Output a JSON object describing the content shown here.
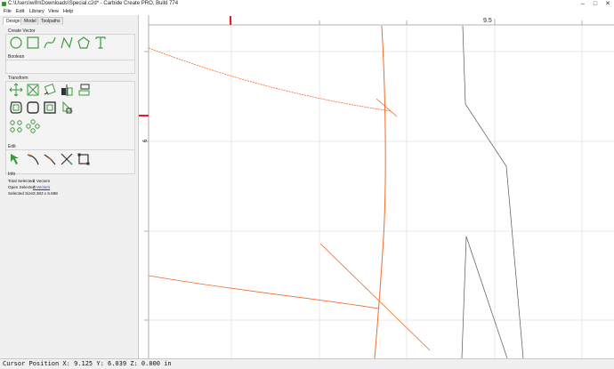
{
  "window": {
    "title": "C:\\Users\\wifn\\Downloads\\Special.c2d* - Carbide Create PRO, Build 774",
    "controls": [
      "minimize-icon",
      "maximize-icon",
      "close-icon"
    ]
  },
  "menu": [
    "File",
    "Edit",
    "Library",
    "View",
    "Help"
  ],
  "tabs": {
    "items": [
      "Design",
      "Model",
      "Toolpaths"
    ],
    "active": "Design"
  },
  "sections": {
    "create_vector": "Create Vector",
    "boolean": "Boolean",
    "transform": "Transform",
    "edit": "Edit",
    "info": "Info"
  },
  "tools": {
    "create_vector": [
      "circle-icon",
      "rectangle-icon",
      "curve-icon",
      "polyline-icon",
      "polygon-icon",
      "text-icon"
    ],
    "transform": [
      "move-icon",
      "scale-icon",
      "rotate-icon",
      "mirror-icon",
      "align-icon",
      "offset-icon",
      "fillet-icon",
      "inset-icon",
      "jitter-icon",
      "array-icon",
      "circular-array-icon"
    ],
    "edit": [
      "node-edit-icon",
      "smooth-icon",
      "corner-icon",
      "trim-icon",
      "join-icon"
    ]
  },
  "info": {
    "total_selected_label": "Total Selected:",
    "total_selected_value": "4 Vectors",
    "open_selected_label": "Open Selected:",
    "open_selected_value": "0 Vectors",
    "selected_size_label": "Selected Size:",
    "selected_size_value": "3.383 x 6.698"
  },
  "ruler": {
    "top_label": "9.5",
    "left_label": "6"
  },
  "colors": {
    "accent": "#3a9a3a",
    "selection": "#f06a2a",
    "vector": "#555555",
    "marker": "#e81c24"
  },
  "status": "Cursor Position X: 9.125 Y: 6.039 Z: 0.000 in"
}
